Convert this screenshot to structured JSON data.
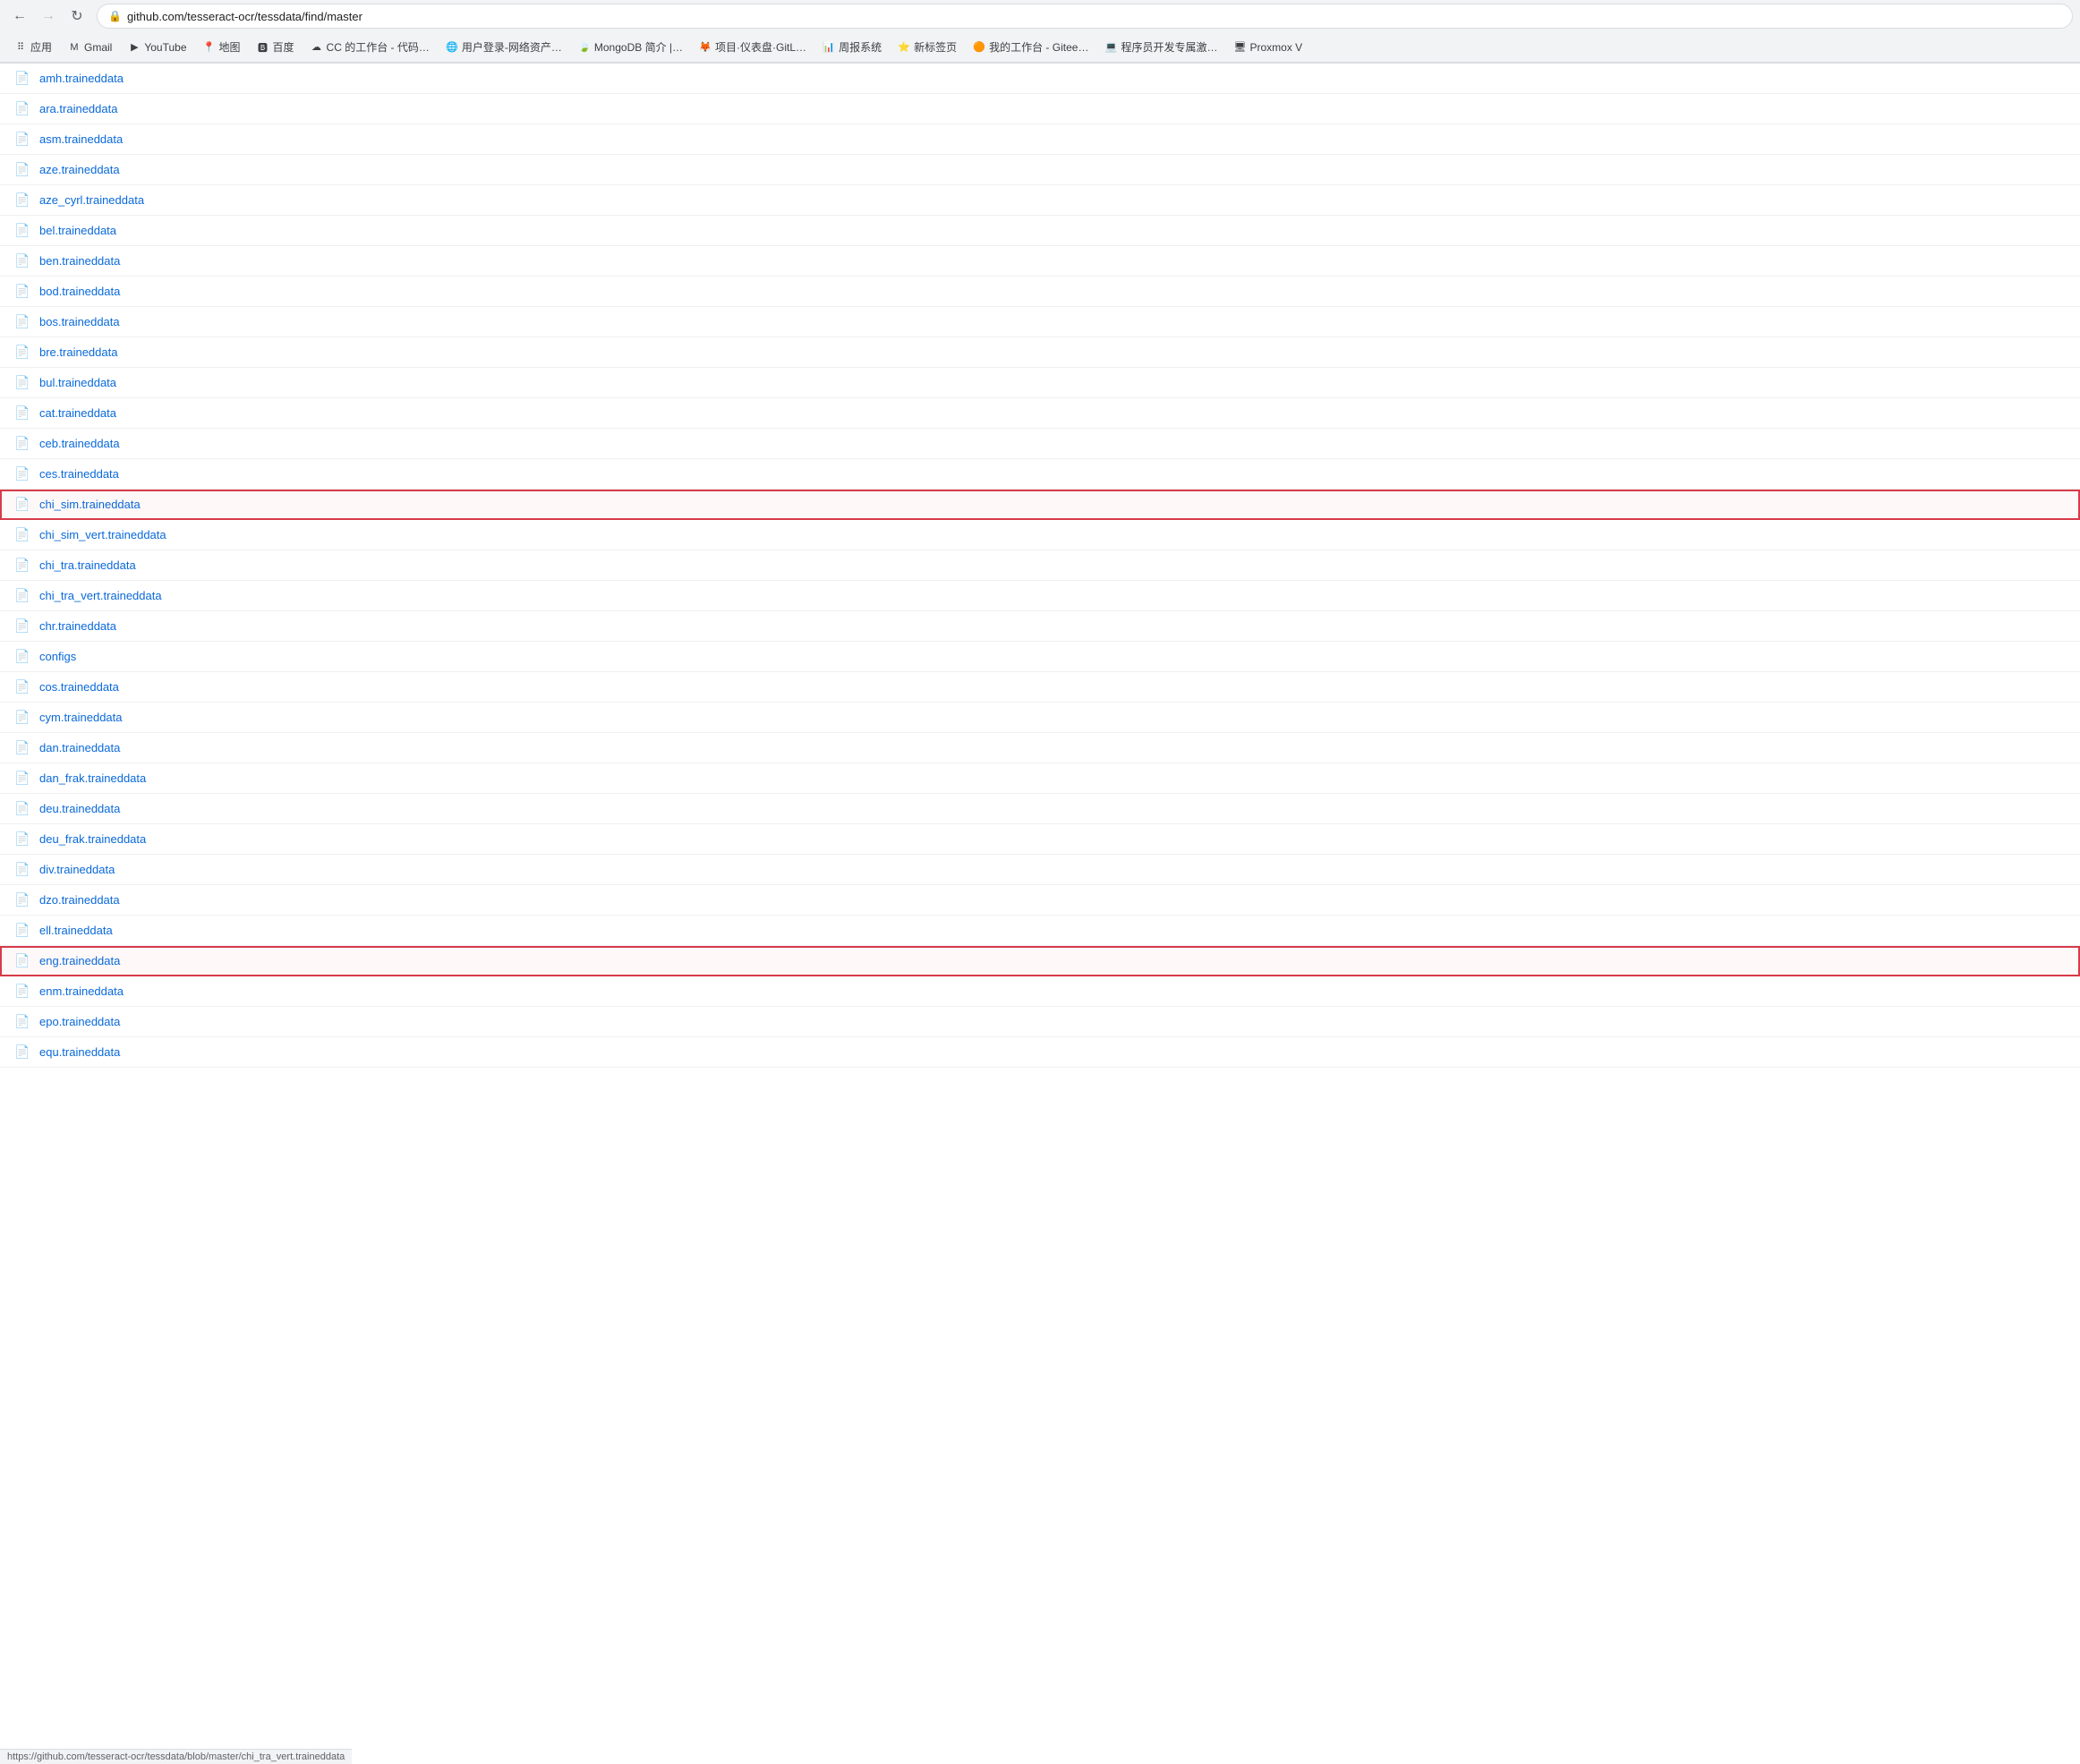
{
  "browser": {
    "back_disabled": false,
    "forward_disabled": true,
    "url": "github.com/tesseract-ocr/tessdata/find/master",
    "url_full": "https://github.com/tesseract-ocr/tessdata/find/master"
  },
  "bookmarks": [
    {
      "id": "apps",
      "label": "应用",
      "icon": "⠿"
    },
    {
      "id": "gmail",
      "label": "Gmail",
      "icon": "M"
    },
    {
      "id": "youtube",
      "label": "YouTube",
      "icon": "▶"
    },
    {
      "id": "maps",
      "label": "地图",
      "icon": "📍"
    },
    {
      "id": "baidu",
      "label": "百度",
      "icon": "🅱"
    },
    {
      "id": "cc-work",
      "label": "CC 的工作台 - 代码…",
      "icon": "☁"
    },
    {
      "id": "user-login",
      "label": "用户登录-网络资产…",
      "icon": "🌐"
    },
    {
      "id": "mongodb",
      "label": "MongoDB 简介 |…",
      "icon": "🍃"
    },
    {
      "id": "project",
      "label": "项目·仪表盘·GitL…",
      "icon": "🦊"
    },
    {
      "id": "report",
      "label": "周报系统",
      "icon": "📊"
    },
    {
      "id": "new-tab",
      "label": "新标签页",
      "icon": "⭐"
    },
    {
      "id": "my-work",
      "label": "我的工作台 - Gitee…",
      "icon": "🟠"
    },
    {
      "id": "dev",
      "label": "程序员开发专属激…",
      "icon": "💻"
    },
    {
      "id": "proxmox",
      "label": "Proxmox V",
      "icon": "🖥"
    }
  ],
  "files": [
    {
      "name": "amh.traineddata",
      "highlighted": false
    },
    {
      "name": "ara.traineddata",
      "highlighted": false
    },
    {
      "name": "asm.traineddata",
      "highlighted": false
    },
    {
      "name": "aze.traineddata",
      "highlighted": false
    },
    {
      "name": "aze_cyrl.traineddata",
      "highlighted": false
    },
    {
      "name": "bel.traineddata",
      "highlighted": false
    },
    {
      "name": "ben.traineddata",
      "highlighted": false
    },
    {
      "name": "bod.traineddata",
      "highlighted": false
    },
    {
      "name": "bos.traineddata",
      "highlighted": false
    },
    {
      "name": "bre.traineddata",
      "highlighted": false
    },
    {
      "name": "bul.traineddata",
      "highlighted": false
    },
    {
      "name": "cat.traineddata",
      "highlighted": false
    },
    {
      "name": "ceb.traineddata",
      "highlighted": false
    },
    {
      "name": "ces.traineddata",
      "highlighted": false
    },
    {
      "name": "chi_sim.traineddata",
      "highlighted": true
    },
    {
      "name": "chi_sim_vert.traineddata",
      "highlighted": false
    },
    {
      "name": "chi_tra.traineddata",
      "highlighted": false
    },
    {
      "name": "chi_tra_vert.traineddata",
      "highlighted": false
    },
    {
      "name": "chr.traineddata",
      "highlighted": false
    },
    {
      "name": "configs",
      "highlighted": false
    },
    {
      "name": "cos.traineddata",
      "highlighted": false
    },
    {
      "name": "cym.traineddata",
      "highlighted": false
    },
    {
      "name": "dan.traineddata",
      "highlighted": false
    },
    {
      "name": "dan_frak.traineddata",
      "highlighted": false
    },
    {
      "name": "deu.traineddata",
      "highlighted": false
    },
    {
      "name": "deu_frak.traineddata",
      "highlighted": false
    },
    {
      "name": "div.traineddata",
      "highlighted": false
    },
    {
      "name": "dzo.traineddata",
      "highlighted": false
    },
    {
      "name": "ell.traineddata",
      "highlighted": false
    },
    {
      "name": "eng.traineddata",
      "highlighted": true
    },
    {
      "name": "enm.traineddata",
      "highlighted": false
    },
    {
      "name": "epo.traineddata",
      "highlighted": false
    },
    {
      "name": "equ.traineddata",
      "highlighted": false
    }
  ],
  "status_bar": {
    "text": "https://github.com/tesseract-ocr/tessdata/blob/master/chi_tra_vert.traineddata"
  },
  "colors": {
    "link": "#0969da",
    "highlight_border": "#d73a49",
    "icon": "#57606a"
  }
}
